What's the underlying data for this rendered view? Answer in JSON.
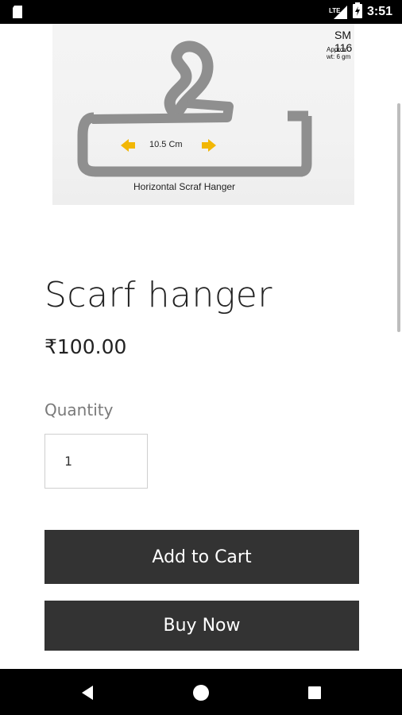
{
  "status_bar": {
    "time": "3:51",
    "network": "LTE",
    "icons": [
      "sd-card-icon",
      "lte-signal-icon",
      "battery-charging-icon"
    ]
  },
  "product": {
    "image": {
      "code": "SM 116",
      "weight": "Approx wt: 6 gm",
      "measurement": "10.5 Cm",
      "caption": "Horizontal Scraf Hanger"
    },
    "title": "Scarf hanger",
    "price": "₹100.00",
    "quantity_label": "Quantity",
    "quantity_value": "1"
  },
  "actions": {
    "add_to_cart": "Add to Cart",
    "buy_now": "Buy Now"
  },
  "nav_bar": {
    "icons": [
      "back-icon",
      "home-icon",
      "recents-icon"
    ]
  },
  "colors": {
    "button_bg": "#333333",
    "text": "#222222",
    "label": "#7a7a7a",
    "arrow": "#f2b705"
  }
}
